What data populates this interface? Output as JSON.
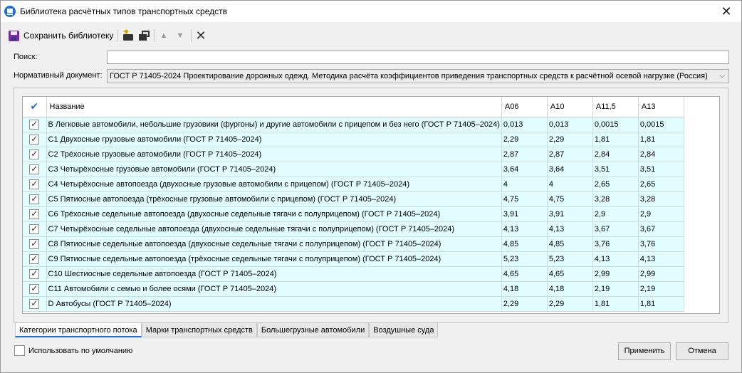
{
  "window": {
    "title": "Библиотека расчётных типов транспортных средств",
    "close_glyph": "✕"
  },
  "toolbar": {
    "save_label": "Сохранить библиотеку"
  },
  "filters": {
    "search_label": "Поиск:",
    "search_value": "",
    "doc_label": "Нормативный документ:",
    "doc_value": "ГОСТ Р 71405-2024 Проектирование дорожных одежд. Методика расчёта коэффициентов приведения транспортных средств к расчётной осевой нагрузке (Россия)"
  },
  "grid": {
    "columns": [
      "Название",
      "А06",
      "А10",
      "А11,5",
      "А13"
    ],
    "rows": [
      {
        "checked": true,
        "name": "B Легковые автомобили, небольшие грузовики (фургоны) и другие автомобили с прицепом и без него (ГОСТ Р 71405–2024)",
        "v": [
          "0,013",
          "0,013",
          "0,0015",
          "0,0015"
        ]
      },
      {
        "checked": true,
        "name": "C1 Двухосные грузовые автомобили (ГОСТ Р 71405–2024)",
        "v": [
          "2,29",
          "2,29",
          "1,81",
          "1,81"
        ]
      },
      {
        "checked": true,
        "name": "C2 Трёхосные грузовые автомобили (ГОСТ Р 71405–2024)",
        "v": [
          "2,87",
          "2,87",
          "2,84",
          "2,84"
        ]
      },
      {
        "checked": true,
        "name": "C3 Четырёхосные грузовые автомобили (ГОСТ Р 71405–2024)",
        "v": [
          "3,64",
          "3,64",
          "3,51",
          "3,51"
        ]
      },
      {
        "checked": true,
        "name": "C4 Четырёхосные автопоезда (двухосные грузовые автомобили с прицепом) (ГОСТ Р 71405–2024)",
        "v": [
          "4",
          "4",
          "2,65",
          "2,65"
        ]
      },
      {
        "checked": true,
        "name": "C5 Пятиосные автопоезда (трёхосные грузовые автомобили с прицепом) (ГОСТ Р 71405–2024)",
        "v": [
          "4,75",
          "4,75",
          "3,28",
          "3,28"
        ]
      },
      {
        "checked": true,
        "name": "C6 Трёхосные седельные автопоезда (двухосные седельные тягачи с полуприцепом) (ГОСТ Р 71405–2024)",
        "v": [
          "3,91",
          "3,91",
          "2,9",
          "2,9"
        ]
      },
      {
        "checked": true,
        "name": "C7 Четырёхосные седельные автопоезда (двухосные седельные тягачи с полуприцепом) (ГОСТ Р 71405–2024)",
        "v": [
          "4,13",
          "4,13",
          "3,67",
          "3,67"
        ]
      },
      {
        "checked": true,
        "name": "C8 Пятиосные седельные автопоезда (двухосные седельные тягачи с полуприцепом) (ГОСТ Р 71405–2024)",
        "v": [
          "4,85",
          "4,85",
          "3,76",
          "3,76"
        ]
      },
      {
        "checked": true,
        "name": "C9 Пятиосные седельные автопоезда (трёхосные седельные тягачи с полуприцепом) (ГОСТ Р 71405–2024)",
        "v": [
          "5,23",
          "5,23",
          "4,13",
          "4,13"
        ]
      },
      {
        "checked": true,
        "name": "C10 Шестиосные седельные автопоезда (ГОСТ Р 71405–2024)",
        "v": [
          "4,65",
          "4,65",
          "2,99",
          "2,99"
        ]
      },
      {
        "checked": true,
        "name": "C11 Автомобили с семью и более осями (ГОСТ Р 71405–2024)",
        "v": [
          "4,18",
          "4,18",
          "2,19",
          "2,19"
        ]
      },
      {
        "checked": true,
        "name": "D Автобусы (ГОСТ Р 71405–2024)",
        "v": [
          "2,29",
          "2,29",
          "1,81",
          "1,81"
        ]
      }
    ]
  },
  "tabs": [
    "Категории транспортного потока",
    "Марки транспортных средств",
    "Большегрузные автомобили",
    "Воздушные суда"
  ],
  "footer": {
    "default_label": "Использовать по умолчанию",
    "apply_label": "Применить",
    "cancel_label": "Отмена"
  }
}
